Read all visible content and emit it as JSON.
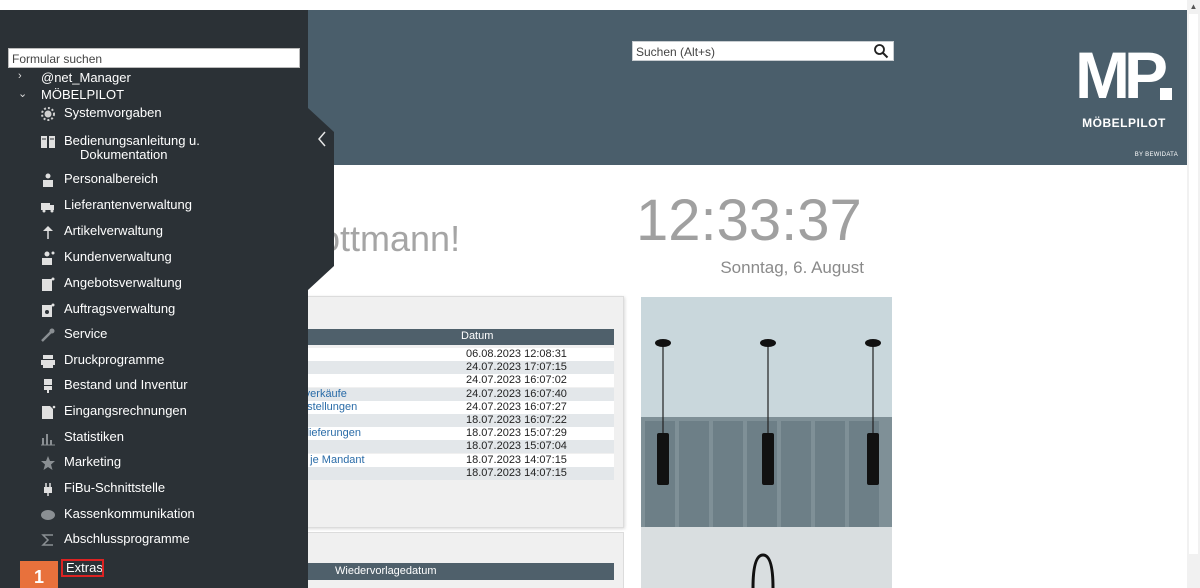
{
  "search": {
    "placeholder": "Suchen (Alt+s)"
  },
  "logo": {
    "mark": "MP",
    "name": "MÖBELPILOT",
    "by": "BY BEWIDATA"
  },
  "greeting": "Flottmann!",
  "clock": {
    "time": "12:33:37",
    "date": "Sonntag, 6. August"
  },
  "table": {
    "header_date": "Datum",
    "rows": [
      {
        "link": "",
        "date": "06.08.2023 12:08:31"
      },
      {
        "link": "",
        "date": "24.07.2023 17:07:15"
      },
      {
        "link": "",
        "date": "24.07.2023 16:07:02"
      },
      {
        "link": "rverkäufe",
        "date": "24.07.2023 16:07:40"
      },
      {
        "link": "estellungen",
        "date": "24.07.2023 16:07:27"
      },
      {
        "link": "",
        "date": "18.07.2023 16:07:22"
      },
      {
        "link": "slieferungen",
        "date": "18.07.2023 15:07:29"
      },
      {
        "link": "",
        "date": "18.07.2023 15:07:04"
      },
      {
        "link": "n je Mandant",
        "date": "18.07.2023 14:07:15"
      },
      {
        "link": "",
        "date": "18.07.2023 14:07:15"
      }
    ]
  },
  "table2": {
    "header": "Wiedervorlagedatum"
  },
  "sidebar": {
    "form_search_placeholder": "Formular suchen",
    "tree": [
      {
        "label": "@net_Manager",
        "chevron": "›"
      },
      {
        "label": "MÖBELPILOT",
        "chevron": "⌄"
      }
    ],
    "items": [
      {
        "label": "Systemvorgaben",
        "icon": "gear-icon"
      },
      {
        "label": "Bedienungsanleitung u.",
        "label2": "Dokumentation",
        "icon": "book-icon"
      },
      {
        "label": "Personalbereich",
        "icon": "person-icon"
      },
      {
        "label": "Lieferantenverwaltung",
        "icon": "truck-icon"
      },
      {
        "label": "Artikelverwaltung",
        "icon": "lamp-icon"
      },
      {
        "label": "Kundenverwaltung",
        "icon": "customer-icon"
      },
      {
        "label": "Angebotsverwaltung",
        "icon": "offer-icon"
      },
      {
        "label": "Auftragsverwaltung",
        "icon": "order-icon"
      },
      {
        "label": "Service",
        "icon": "wrench-icon"
      },
      {
        "label": "Druckprogramme",
        "icon": "printer-icon"
      },
      {
        "label": "Bestand und Inventur",
        "icon": "inventory-icon"
      },
      {
        "label": "Eingangsrechnungen",
        "icon": "invoice-icon"
      },
      {
        "label": "Statistiken",
        "icon": "bar-chart-icon"
      },
      {
        "label": "Marketing",
        "icon": "star-icon"
      },
      {
        "label": "FiBu-Schnittstelle",
        "icon": "plug-icon"
      },
      {
        "label": "Kassenkommunikation",
        "icon": "chat-icon"
      },
      {
        "label": "Abschlussprogramme",
        "icon": "sum-icon"
      },
      {
        "label": "Extras",
        "icon": ""
      }
    ],
    "step_badge": "1"
  },
  "colors": {
    "header": "#4a5e6b",
    "sidebar": "#2b3136",
    "badge": "#e8713c",
    "highlight": "#dd2222"
  }
}
